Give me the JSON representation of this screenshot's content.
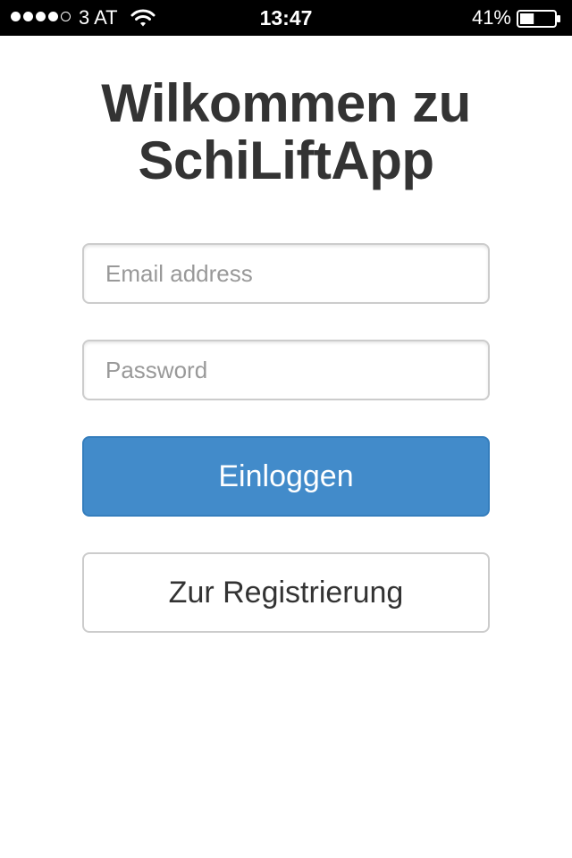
{
  "status_bar": {
    "signal_bars_filled": 4,
    "signal_bars_total": 5,
    "carrier": "3 AT",
    "time": "13:47",
    "battery_percent_label": "41%",
    "battery_level": 0.41
  },
  "title": {
    "line1": "Wilkommen zu",
    "line2": "SchiLiftApp"
  },
  "form": {
    "email_placeholder": "Email address",
    "email_value": "",
    "password_placeholder": "Password",
    "password_value": ""
  },
  "buttons": {
    "login_label": "Einloggen",
    "register_label": "Zur Registrierung"
  },
  "colors": {
    "primary": "#428bca",
    "text": "#333333",
    "status_bar_bg": "#000000"
  }
}
